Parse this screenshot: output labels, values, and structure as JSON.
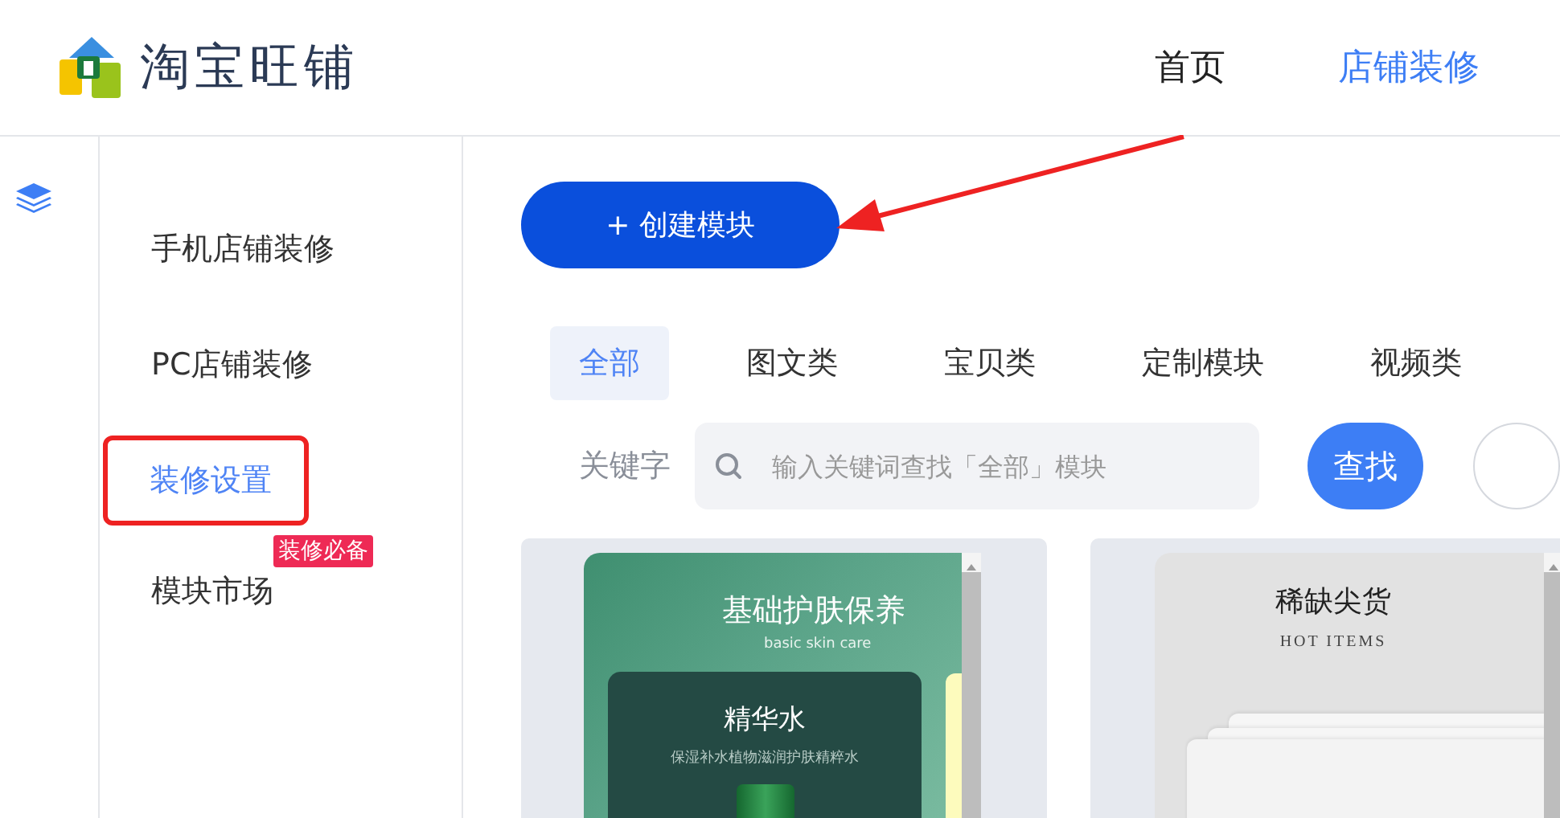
{
  "logo": {
    "text": "淘宝旺铺"
  },
  "nav": [
    {
      "label": "首页",
      "selected": false
    },
    {
      "label": "店铺装修",
      "selected": true
    }
  ],
  "sidebar": {
    "items": [
      {
        "label": "手机店铺装修",
        "selected": false,
        "highlighted": false
      },
      {
        "label": "PC店铺装修",
        "selected": false,
        "highlighted": false
      },
      {
        "label": "装修设置",
        "selected": true,
        "highlighted": true
      },
      {
        "label": "模块市场",
        "selected": false,
        "highlighted": false,
        "badge": "装修必备"
      }
    ]
  },
  "create_button": {
    "label": "+ 创建模块",
    "arrow_pointed": true
  },
  "filters": {
    "tabs": [
      {
        "label": "全部",
        "selected": true
      },
      {
        "label": "图文类",
        "selected": false
      },
      {
        "label": "宝贝类",
        "selected": false
      },
      {
        "label": "定制模块",
        "selected": false
      },
      {
        "label": "视频类",
        "selected": false
      }
    ],
    "keyword_label": "关键字",
    "search": {
      "placeholder": "输入关键词查找「全部」模块"
    },
    "search_button": "查找"
  },
  "modules": [
    {
      "kind": "skincare",
      "title": "基础护肤保养",
      "subtitle": "basic skin care",
      "product_name": "精华水",
      "product_desc": "保湿补水植物滋润护肤精粹水"
    },
    {
      "kind": "hot",
      "title": "稀缺尖货",
      "subtitle": "HOT ITEMS"
    }
  ]
}
